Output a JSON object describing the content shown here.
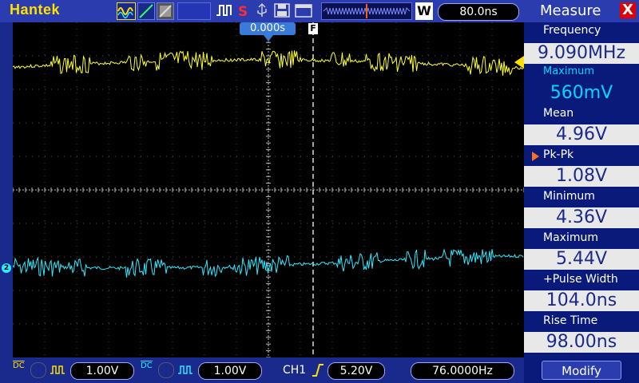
{
  "app": {
    "brand": "Hantek"
  },
  "toolbar": {
    "time_div": "80.0ns",
    "window_badge": "W",
    "trigger_time": "0.000s",
    "trigger_marker": "F"
  },
  "colors": {
    "ch1": "#ffff30",
    "ch2": "#30e8ff",
    "panel_bg": "#0a1a7a",
    "accent_red": "#e00000"
  },
  "channels": [
    {
      "coupling": "DC",
      "volts_div": "1.00V"
    },
    {
      "coupling": "DC",
      "volts_div": "1.00V"
    }
  ],
  "trigger": {
    "source": "CH1",
    "level": "5.20V",
    "frequency": "76.0000Hz"
  },
  "measure": {
    "title": "Measure",
    "close_label": "X",
    "items": [
      {
        "label": "Frequency",
        "value": "9.090MHz"
      },
      {
        "label": "Maximum",
        "value": "560mV"
      },
      {
        "label": "Mean",
        "value": "4.96V"
      },
      {
        "label": "Pk-Pk",
        "value": "1.08V"
      },
      {
        "label": "Minimum",
        "value": "4.36V"
      },
      {
        "label": "Maximum",
        "value": "5.44V"
      },
      {
        "label": "+Pulse Width",
        "value": "104.0ns"
      },
      {
        "label": "Rise Time",
        "value": "98.00ns"
      }
    ],
    "modify_label": "Modify"
  }
}
